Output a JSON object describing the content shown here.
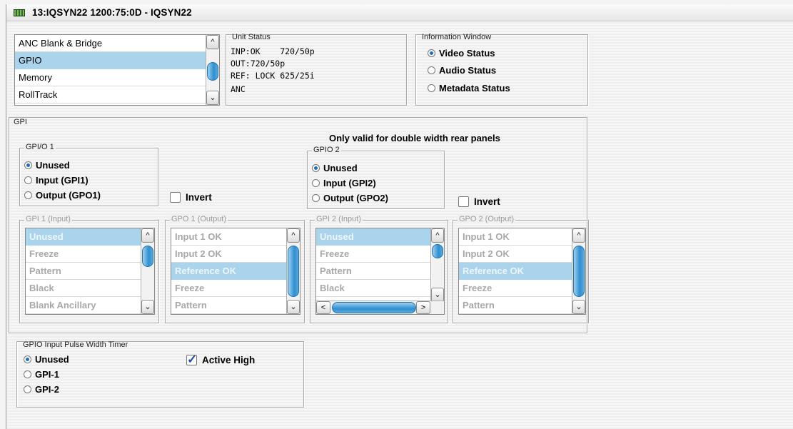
{
  "window": {
    "title": "13:IQSYN22  1200:75:0D  - IQSYN22"
  },
  "nav_list": {
    "items": [
      "ANC Blank & Bridge",
      "GPIO",
      "Memory",
      "RollTrack"
    ],
    "selected_index": 1
  },
  "unit_status": {
    "title": "Unit Status",
    "lines": [
      "INP:OK    720/50p",
      "OUT:720/50p",
      "REF: LOCK 625/25i",
      "ANC"
    ]
  },
  "info_window": {
    "title": "Information Window",
    "options": [
      "Video Status",
      "Audio Status",
      "Metadata Status"
    ],
    "selected_index": 0
  },
  "gpi": {
    "title": "GPI",
    "note": "Only valid for double width rear panels",
    "gpio1": {
      "title": "GPI/O 1",
      "options": [
        "Unused",
        "Input (GPI1)",
        "Output (GPO1)"
      ],
      "selected_index": 0,
      "invert_label": "Invert",
      "invert_checked": false
    },
    "gpio2": {
      "title": "GPIO 2",
      "options": [
        "Unused",
        "Input (GPI2)",
        "Output (GPO2)"
      ],
      "selected_index": 0,
      "invert_label": "Invert",
      "invert_checked": false
    },
    "gpi1_input": {
      "title": "GPI 1 (Input)",
      "items": [
        "Unused",
        "Freeze",
        "Pattern",
        "Black",
        "Blank Ancillary"
      ],
      "selected_index": 0
    },
    "gpo1_output": {
      "title": "GPO 1 (Output)",
      "items": [
        "Input 1 OK",
        "Input 2 OK",
        "Reference OK",
        "Freeze",
        "Pattern"
      ],
      "selected_index": 2
    },
    "gpi2_input": {
      "title": "GPI 2 (Input)",
      "items": [
        "Unused",
        "Freeze",
        "Pattern",
        "Black"
      ],
      "selected_index": 0
    },
    "gpo2_output": {
      "title": "GPO 2 (Output)",
      "items": [
        "Input 1 OK",
        "Input 2 OK",
        "Reference OK",
        "Freeze",
        "Pattern"
      ],
      "selected_index": 2
    }
  },
  "pulse_timer": {
    "title": "GPIO Input Pulse Width Timer",
    "options": [
      "Unused",
      "GPI-1",
      "GPI-2"
    ],
    "selected_index": 0,
    "active_high_label": "Active High",
    "active_high_checked": true
  },
  "colors": {
    "selection": "#a9d4ec",
    "scroll_thumb": "#2f8fd0",
    "radio_dot": "#1b6fc1"
  }
}
